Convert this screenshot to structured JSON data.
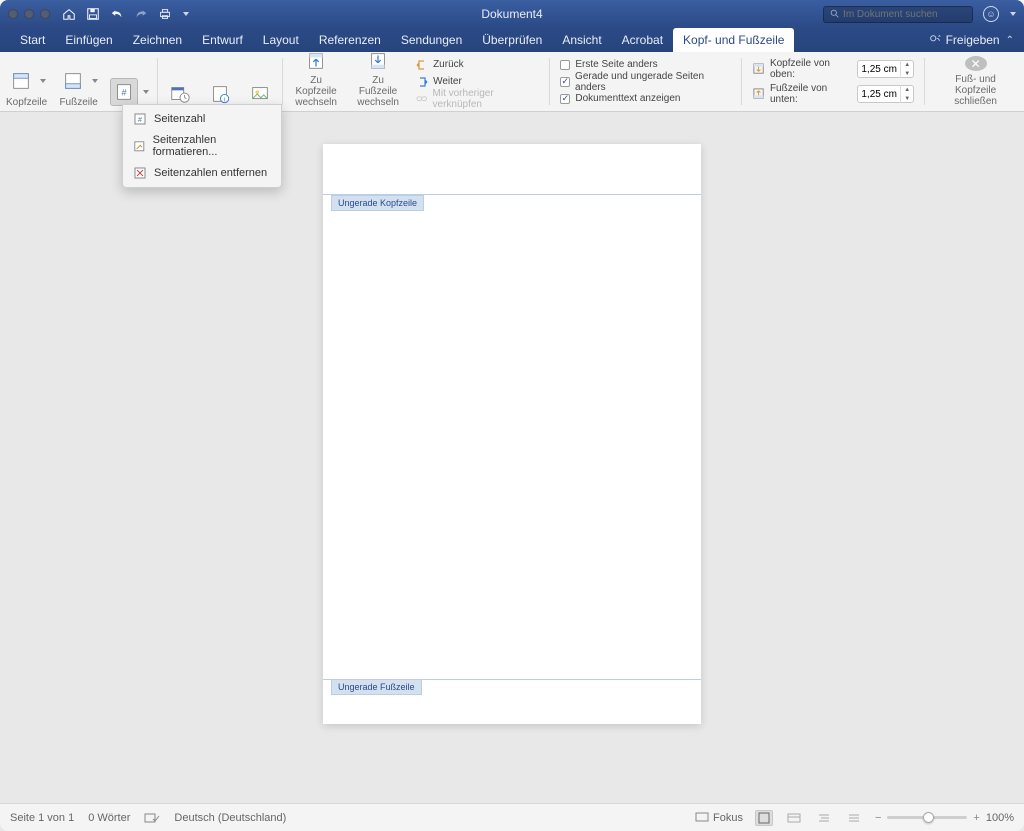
{
  "title": "Dokument4",
  "search_placeholder": "Im Dokument suchen",
  "share_label": "Freigeben",
  "tabs": [
    "Start",
    "Einfügen",
    "Zeichnen",
    "Entwurf",
    "Layout",
    "Referenzen",
    "Sendungen",
    "Überprüfen",
    "Ansicht",
    "Acrobat",
    "Kopf- und Fußzeile"
  ],
  "active_tab": "Kopf- und Fußzeile",
  "ribbon": {
    "kopfzeile": "Kopfzeile",
    "fusszeile": "Fußzeile",
    "seitenzahl": "Seitenzahl",
    "datumuhr": "Datum und Uhrzeit",
    "dokinfo": "Dokument-informationen",
    "bilder": "Bilder",
    "zukopf": "Zu Kopfzeile wechseln",
    "zufuss": "Zu Fußzeile wechseln",
    "zurueck": "Zurück",
    "weiter": "Weiter",
    "verknuepfen": "Mit vorheriger verknüpfen",
    "erste": "Erste Seite anders",
    "gerade": "Gerade und ungerade Seiten anders",
    "doktext": "Dokumenttext anzeigen",
    "kopfvonoben": "Kopfzeile von oben:",
    "fussvonunten": "Fußzeile von unten:",
    "meas_kopf": "1,25 cm",
    "meas_fuss": "1,25 cm",
    "close": "Fuß- und Kopfzeile schließen"
  },
  "dropdown": {
    "item1": "Seitenzahl",
    "item2": "Seitenzahlen formatieren...",
    "item3": "Seitenzahlen entfernen"
  },
  "page": {
    "header_badge": "Ungerade Kopfzeile",
    "footer_badge": "Ungerade Fußzeile"
  },
  "status": {
    "page": "Seite 1 von 1",
    "words": "0 Wörter",
    "lang": "Deutsch (Deutschland)",
    "fokus": "Fokus",
    "zoom": "100%"
  }
}
